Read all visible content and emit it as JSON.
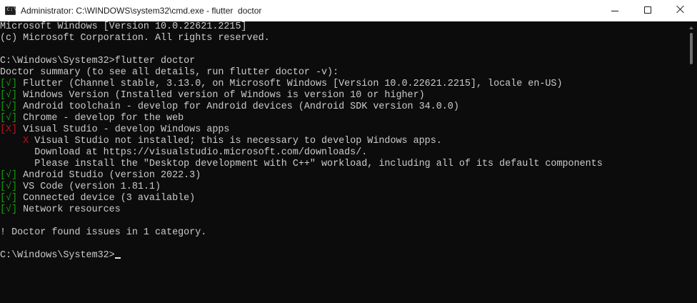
{
  "window": {
    "title": "Administrator: C:\\WINDOWS\\system32\\cmd.exe - flutter  doctor",
    "icon": "cmd-icon",
    "icon_glyph": "c:\\"
  },
  "controls": {
    "minimize": "minimize-icon",
    "maximize": "maximize-icon",
    "close": "close-icon"
  },
  "colors": {
    "background": "#0c0c0c",
    "text": "#cccccc",
    "ok": "#13a10e",
    "error": "#c50f1f"
  },
  "console": {
    "lines": [
      {
        "text": "Microsoft Windows [Version 10.0.22621.2215]"
      },
      {
        "text": "(c) Microsoft Corporation. All rights reserved."
      },
      {
        "text": ""
      },
      {
        "text": "C:\\Windows\\System32>flutter doctor"
      },
      {
        "text": "Doctor summary (to see all details, run flutter doctor -v):"
      },
      {
        "marker": "[√]",
        "status": "ok",
        "text": " Flutter (Channel stable, 3.13.0, on Microsoft Windows [Version 10.0.22621.2215], locale en-US)"
      },
      {
        "marker": "[√]",
        "status": "ok",
        "text": " Windows Version (Installed version of Windows is version 10 or higher)"
      },
      {
        "marker": "[√]",
        "status": "ok",
        "text": " Android toolchain - develop for Android devices (Android SDK version 34.0.0)"
      },
      {
        "marker": "[√]",
        "status": "ok",
        "text": " Chrome - develop for the web"
      },
      {
        "marker": "[X]",
        "status": "bad",
        "text": " Visual Studio - develop Windows apps"
      },
      {
        "indent": "    ",
        "marker": "X",
        "status": "bad",
        "text": " Visual Studio not installed; this is necessary to develop Windows apps."
      },
      {
        "text": "      Download at https://visualstudio.microsoft.com/downloads/."
      },
      {
        "text": "      Please install the \"Desktop development with C++\" workload, including all of its default components"
      },
      {
        "marker": "[√]",
        "status": "ok",
        "text": " Android Studio (version 2022.3)"
      },
      {
        "marker": "[√]",
        "status": "ok",
        "text": " VS Code (version 1.81.1)"
      },
      {
        "marker": "[√]",
        "status": "ok",
        "text": " Connected device (3 available)"
      },
      {
        "marker": "[√]",
        "status": "ok",
        "text": " Network resources"
      },
      {
        "text": ""
      },
      {
        "text": "! Doctor found issues in 1 category."
      },
      {
        "text": ""
      },
      {
        "text": "C:\\Windows\\System32>",
        "cursor": true
      }
    ]
  }
}
